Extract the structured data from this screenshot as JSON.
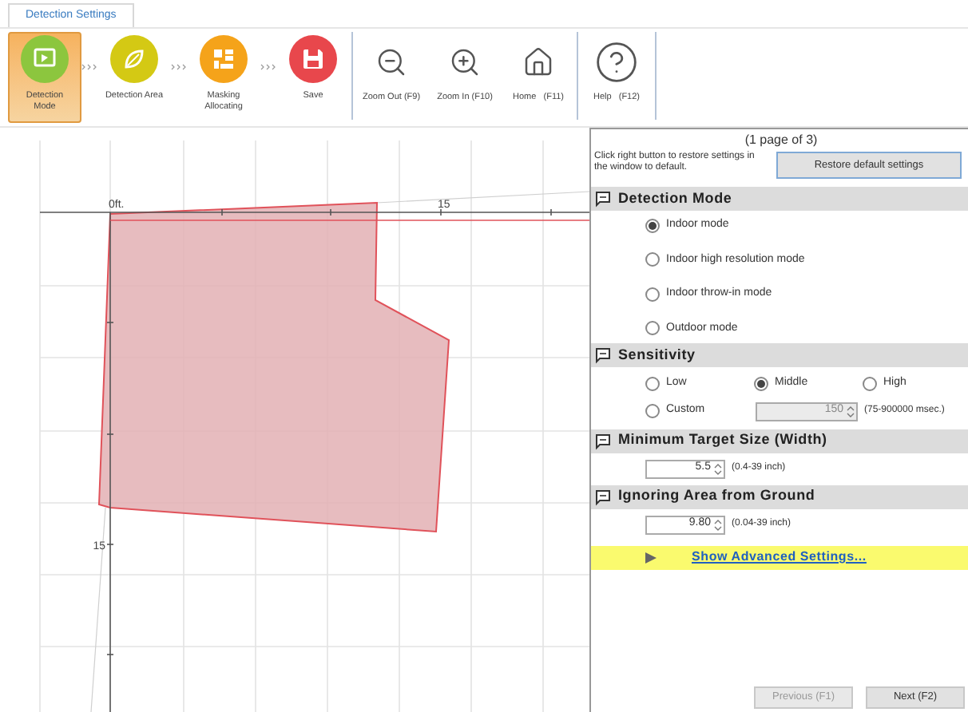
{
  "tabs": [
    {
      "label": "Detection Settings",
      "selected": true
    }
  ],
  "toolbar": [
    {
      "kind": "step",
      "label_lines": [
        "Detection",
        "Mode"
      ],
      "color": "#8cc63e",
      "selected": true
    },
    {
      "kind": "step",
      "label_lines": [
        "Detection Area"
      ],
      "color": "#d4c914",
      "selected": false
    },
    {
      "kind": "step",
      "label_lines": [
        "Masking",
        "Allocating"
      ],
      "color": "#f5a31a",
      "selected": false
    },
    {
      "kind": "step",
      "label_lines": [
        "Save"
      ],
      "color": "#e8474c",
      "selected": false
    },
    {
      "kind": "tool",
      "label_lines": [
        "Zoom Out (F9)"
      ],
      "selected": false
    },
    {
      "kind": "tool",
      "label_lines": [
        "Zoom In (F10)"
      ],
      "selected": false
    },
    {
      "kind": "tool",
      "label_lines": [
        "Home   (F11)"
      ],
      "selected": false
    },
    {
      "kind": "tool",
      "label_lines": [
        "Help   (F12)"
      ],
      "selected": false
    }
  ],
  "canvas": {
    "origin_label": "0ft.",
    "x_label": "15",
    "y_label": "15"
  },
  "panel": {
    "page": "(1  page of 3)",
    "hint": "Click right button to restore settings in the window to default.",
    "restore_button": "Restore default settings",
    "sections": [
      {
        "title": "Detection Mode",
        "kind": "column",
        "options": [
          {
            "label": "Indoor mode",
            "selected": true
          },
          {
            "label": "Indoor high resolution mode",
            "selected": false
          },
          {
            "label": "Indoor throw-in mode",
            "selected": false
          },
          {
            "label": "Outdoor mode",
            "selected": false
          }
        ]
      },
      {
        "title": "Sensitivity",
        "kind": "row",
        "options": [
          {
            "label": "Low",
            "selected": false
          },
          {
            "label": "Middle",
            "selected": true
          },
          {
            "label": "High",
            "selected": false
          }
        ],
        "custom": {
          "label": "Custom",
          "selected": false,
          "value": "150",
          "range": "(75-900000 msec.)",
          "disabled": true
        }
      },
      {
        "title": "Minimum Target Size (Width)",
        "field": {
          "value": "5.5",
          "range": "(0.4-39 inch)",
          "disabled": false
        }
      },
      {
        "title": "Ignoring Area from Ground",
        "field": {
          "value": "9.80",
          "range": "(0.04-39 inch)",
          "disabled": false
        }
      }
    ],
    "advanced_link": "Show Advanced Settings...",
    "buttons": [
      {
        "label": "Previous (F1)",
        "disabled": true
      },
      {
        "label": "Next (F2)",
        "disabled": false
      }
    ]
  }
}
